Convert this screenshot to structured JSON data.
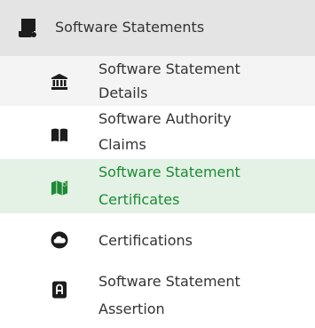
{
  "menu": {
    "header": {
      "label": "Software Statements",
      "icon": "scroll-icon"
    },
    "items": [
      {
        "label_line1": "Software Statement",
        "label_line2": "Details",
        "icon": "bank-icon"
      },
      {
        "label_line1": "Software Authority",
        "label_line2": "Claims",
        "icon": "book-icon"
      },
      {
        "label_line1": "Software Statement",
        "label_line2": "Certificates",
        "icon": "map-icon"
      },
      {
        "label_line1": "Certifications",
        "icon": "cloud-icon"
      },
      {
        "label_line1": "Software Statement",
        "label_line2": "Assertion",
        "icon": "letter-a-icon"
      }
    ]
  },
  "colors": {
    "header_bg": "#e4e4e4",
    "active_bg": "#e3f2e5",
    "active_text": "#1e8a35",
    "text": "#333333"
  }
}
